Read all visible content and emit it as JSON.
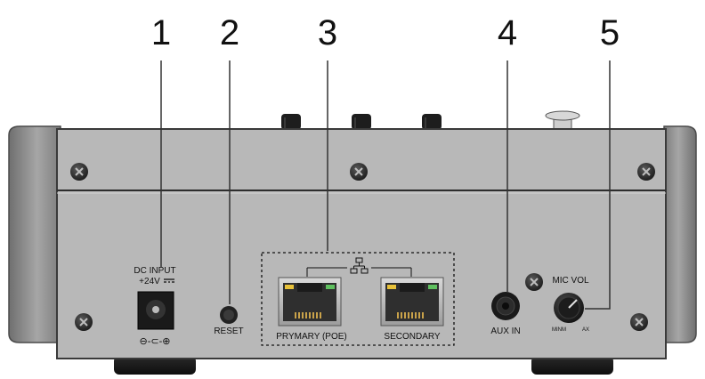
{
  "callouts": [
    "1",
    "2",
    "3",
    "4",
    "5"
  ],
  "dc_input": {
    "label": "DC INPUT",
    "voltage": "+24V",
    "polarity": "⊖-⊂-⊕"
  },
  "reset": {
    "label": "RESET"
  },
  "network": {
    "icon": "network-icon",
    "primary_label": "PRYMARY (POE)",
    "secondary_label": "SECONDARY"
  },
  "aux": {
    "label": "AUX IN"
  },
  "mic": {
    "label": "MIC VOL",
    "min_label": "MINM",
    "max_label": "AX"
  },
  "colors": {
    "panel": "#b8b8b8",
    "panel_edge": "#3a3a3a",
    "bumper": "#8c8c8c",
    "knob": "#2b2b2b",
    "leader": "#333333"
  }
}
